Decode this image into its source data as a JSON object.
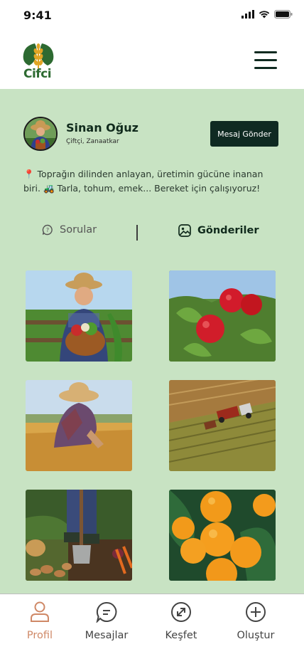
{
  "status_bar": {
    "time": "9:41"
  },
  "header": {
    "logo_text": "Cifci",
    "menu_icon": "hamburger-menu-icon"
  },
  "profile": {
    "name": "Sinan Oğuz",
    "role": "Çiftçi, Zanaatkar",
    "message_button": "Mesaj Gönder",
    "bio": "📍 Toprağın dilinden anlayan, üretimin gücüne inanan biri. 🚜 Tarla, tohum, emek... Bereket için çalışıyoruz!"
  },
  "tabs": [
    {
      "label": "Sorular",
      "icon": "question-chat-icon",
      "active": false
    },
    {
      "label": "Gönderiler",
      "icon": "image-icon",
      "active": true
    }
  ],
  "posts": [
    {
      "subject": "farmer-with-vegetable-basket"
    },
    {
      "subject": "red-nectarines-on-branch"
    },
    {
      "subject": "farmer-harvesting-wheat"
    },
    {
      "subject": "tractor-in-field-aerial"
    },
    {
      "subject": "digging-potatoes"
    },
    {
      "subject": "tangerines-on-branch"
    }
  ],
  "bottom_nav": [
    {
      "label": "Profil",
      "icon": "user-icon",
      "active": true
    },
    {
      "label": "Mesajlar",
      "icon": "chat-icon",
      "active": false
    },
    {
      "label": "Keşfet",
      "icon": "compass-icon",
      "active": false
    },
    {
      "label": "Oluştur",
      "icon": "plus-circle-icon",
      "active": false
    }
  ],
  "colors": {
    "accent": "#cf8866",
    "background": "#c8e3c3",
    "dark": "#0f2a22"
  }
}
